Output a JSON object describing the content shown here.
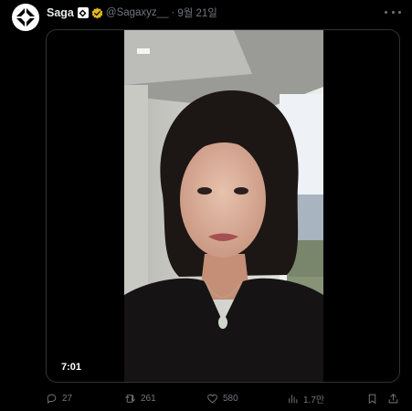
{
  "author": {
    "display_name": "Saga",
    "handle": "@Sagaxyz__",
    "separator": "·",
    "date": "9월 21일"
  },
  "video": {
    "duration": "7:01"
  },
  "actions": {
    "replies": "27",
    "retweets": "261",
    "likes": "580",
    "views": "1.7만"
  },
  "colors": {
    "background": "#000000",
    "primary_text": "#e7e9ea",
    "secondary_text": "#71767b",
    "verified_badge": "#e2b719",
    "border": "#2f3336"
  },
  "icons": [
    "saga-logo-icon",
    "affiliate-badge-icon",
    "verified-badge-icon",
    "more-icon",
    "reply-icon",
    "retweet-icon",
    "like-icon",
    "views-icon",
    "bookmark-icon",
    "share-icon"
  ]
}
